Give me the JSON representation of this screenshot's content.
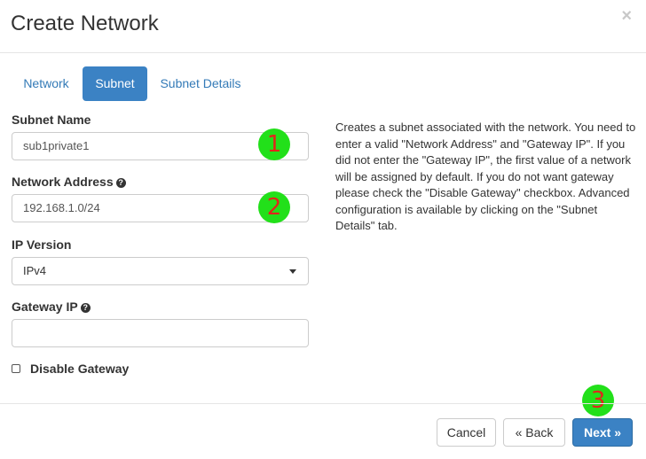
{
  "modal": {
    "title": "Create Network",
    "close": "×"
  },
  "tabs": [
    {
      "label": "Network",
      "active": false
    },
    {
      "label": "Subnet",
      "active": true
    },
    {
      "label": "Subnet Details",
      "active": false
    }
  ],
  "form": {
    "subnet_name": {
      "label": "Subnet Name",
      "value": "sub1private1"
    },
    "network_address": {
      "label": "Network Address",
      "value": "192.168.1.0/24"
    },
    "ip_version": {
      "label": "IP Version",
      "value": "IPv4"
    },
    "gateway_ip": {
      "label": "Gateway IP",
      "value": ""
    },
    "disable_gateway": {
      "label": "Disable Gateway",
      "checked": false
    }
  },
  "help_text": "Creates a subnet associated with the network. You need to enter a valid \"Network Address\" and \"Gateway IP\". If you did not enter the \"Gateway IP\", the first value of a network will be assigned by default. If you do not want gateway please check the \"Disable Gateway\" checkbox. Advanced configuration is available by clicking on the \"Subnet Details\" tab.",
  "markers": [
    "1",
    "2",
    "3"
  ],
  "buttons": {
    "cancel": "Cancel",
    "back": "« Back",
    "next": "Next »"
  },
  "colors": {
    "primary": "#3b82c4",
    "link": "#337ab7",
    "marker_bg": "#22e01a",
    "marker_text": "#e0261b"
  }
}
